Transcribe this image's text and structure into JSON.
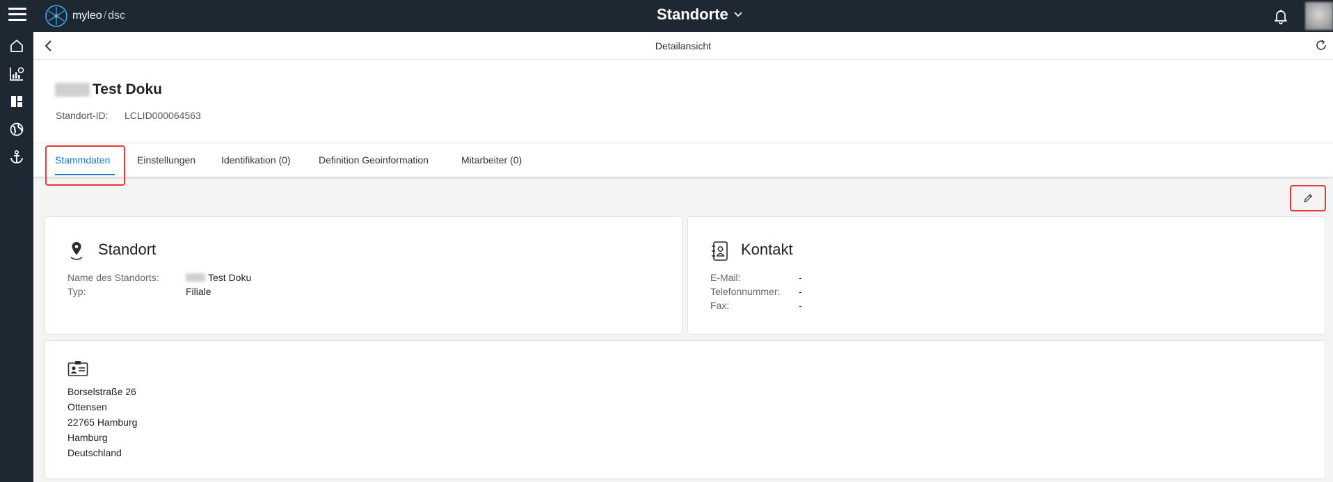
{
  "app": {
    "name": "myleo",
    "sub": "dsc",
    "title": "Standorte"
  },
  "subheader": {
    "title": "Detailansicht"
  },
  "location": {
    "title": "Test Doku",
    "id_label": "Standort-ID:",
    "id_value": "LCLID000064563"
  },
  "tabs": [
    {
      "label": "Stammdaten"
    },
    {
      "label": "Einstellungen"
    },
    {
      "label": "Identifikation (0)"
    },
    {
      "label": "Definition Geoinformation"
    },
    {
      "label": "Mitarbeiter (0)"
    }
  ],
  "standort_card": {
    "title": "Standort",
    "name_label": "Name des Standorts:",
    "name_value": "Test Doku",
    "type_label": "Typ:",
    "type_value": "Filiale"
  },
  "kontakt_card": {
    "title": "Kontakt",
    "email_label": "E-Mail:",
    "email_value": "-",
    "phone_label": "Telefonnummer:",
    "phone_value": "-",
    "fax_label": "Fax:",
    "fax_value": "-"
  },
  "address_card": {
    "lines": [
      "Borselstraße 26",
      "Ottensen",
      "22765 Hamburg",
      "Hamburg",
      "Deutschland"
    ]
  },
  "icons": {
    "menu": "hamburger-icon",
    "logo": "logo-icon",
    "dropdown": "chevron-down-icon",
    "notifications": "bell-icon",
    "back": "chevron-left-icon",
    "refresh": "refresh-icon",
    "edit": "pencil-icon",
    "nav": [
      "home-icon",
      "analytics-icon",
      "dashboard-icon",
      "globe-icon",
      "anchor-icon"
    ],
    "standort": "location-pin-icon",
    "kontakt": "contact-book-icon",
    "address": "id-card-icon"
  },
  "colors": {
    "topbar": "#1e2833",
    "accent": "#1976d2",
    "highlight": "#e53935"
  }
}
